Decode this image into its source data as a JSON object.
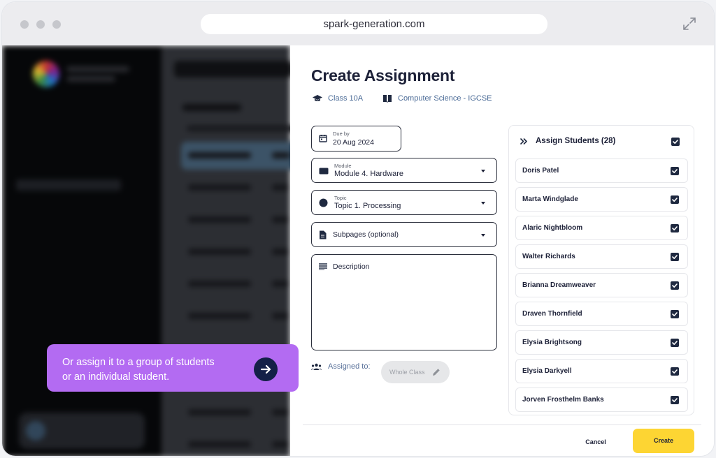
{
  "browser": {
    "url": "spark-generation.com"
  },
  "tooltip": {
    "line1": "Or assign it to a group of students",
    "line2": "or an individual student."
  },
  "modal": {
    "title": "Create Assignment",
    "class_label": "Class 10A",
    "subject_label": "Computer Science - IGCSE",
    "due": {
      "label": "Due by",
      "value": "20 Aug 2024"
    },
    "module": {
      "label": "Module",
      "value": "Module 4. Hardware"
    },
    "topic": {
      "label": "Topic",
      "value": "Topic 1. Processing"
    },
    "subpages": {
      "placeholder": "Subpages (optional)"
    },
    "description": {
      "placeholder": "Description"
    },
    "assigned_to": {
      "label": "Assigned to:",
      "chip": "Whole Class"
    },
    "students_panel": {
      "title": "Assign Students (28)",
      "students": [
        "Doris Patel",
        "Marta Windglade",
        "Alaric Nightbloom",
        "Walter Richards",
        "Brianna Dreamweaver",
        "Draven Thornfield",
        "Elysia Brightsong",
        "Elysia Darkyell",
        "Jorven Frosthelm Banks"
      ]
    },
    "actions": {
      "cancel": "Cancel",
      "create": "Create"
    }
  },
  "colors": {
    "accent_yellow": "#fdd533",
    "tooltip_purple": "#b36bf2",
    "navy": "#1d2138",
    "meta_blue": "#4a6a96"
  }
}
